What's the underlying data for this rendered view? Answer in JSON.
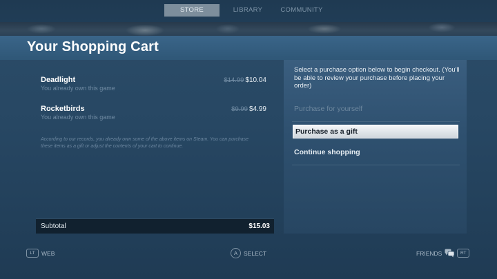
{
  "nav": {
    "tabs": [
      {
        "label": "STORE",
        "active": true
      },
      {
        "label": "LIBRARY",
        "active": false
      },
      {
        "label": "COMMUNITY",
        "active": false
      }
    ]
  },
  "page": {
    "title": "Your Shopping Cart"
  },
  "cart": {
    "items": [
      {
        "name": "Deadlight",
        "note": "You already own this game",
        "old_price": "$14.99",
        "price": "$10.04"
      },
      {
        "name": "Rocketbirds",
        "note": "You already own this game",
        "old_price": "$9.99",
        "price": "$4.99"
      }
    ],
    "records_note": "According to our records, you already own some of the above items on Steam. You can purchase these items as a gift or adjust the contents of your cart to continue.",
    "subtotal_label": "Subtotal",
    "subtotal_value": "$15.03"
  },
  "checkout": {
    "info": "Select a purchase option below to begin checkout. (You'll be able to review your purchase before placing your order)",
    "purchase_self": "Purchase for yourself",
    "purchase_gift": "Purchase as a gift",
    "continue": "Continue shopping"
  },
  "footer": {
    "lt_badge": "LT",
    "web": "WEB",
    "a_badge": "A",
    "select": "SELECT",
    "friends": "FRIENDS",
    "rt_badge": "RT"
  },
  "colors": {
    "background": "#274763",
    "header": "#3a6589",
    "highlight": "#f4f6f8",
    "muted_text": "#6f8aa2"
  },
  "icons": [
    "chat-icon"
  ]
}
